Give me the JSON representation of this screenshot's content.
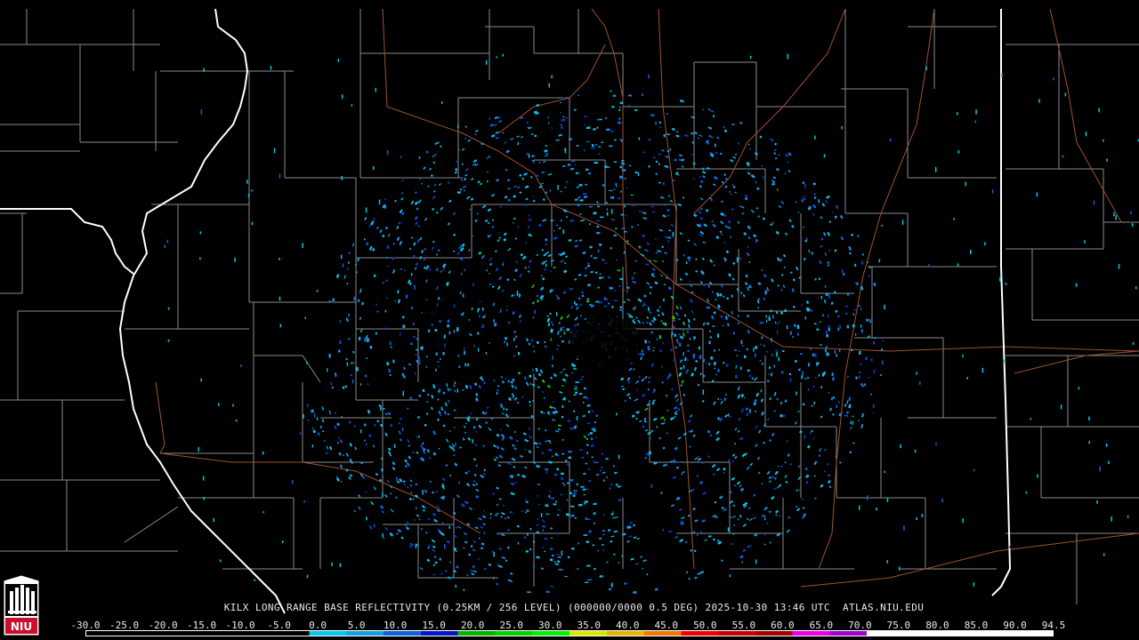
{
  "caption": "KILX LONG RANGE BASE REFLECTIVITY (0.25KM / 256 LEVEL) (000000/0000 0.5 DEG) 2025-10-30 13:46 UTC  ATLAS.NIU.EDU",
  "logo": {
    "text": "NIU",
    "background": "#c8102e"
  },
  "scale": {
    "labels": [
      "-30.0",
      "-25.0",
      "-20.0",
      "-15.0",
      "-10.0",
      "-5.0",
      "0.0",
      "5.0",
      "10.0",
      "15.0",
      "20.0",
      "25.0",
      "30.0",
      "35.0",
      "40.0",
      "45.0",
      "50.0",
      "55.0",
      "60.0",
      "65.0",
      "70.0",
      "75.0",
      "80.0",
      "85.0",
      "90.0",
      "94.5"
    ],
    "colors": [
      "#000000",
      "#000000",
      "#000000",
      "#000000",
      "#000000",
      "#000000",
      "#00c8e8",
      "#14a0e0",
      "#1060d8",
      "#0018c8",
      "#00b400",
      "#00d200",
      "#00f000",
      "#d8e800",
      "#e8b400",
      "#f07800",
      "#f00000",
      "#c80000",
      "#a00000",
      "#e800e8",
      "#a000c8",
      "#ffffff",
      "#ffffff",
      "#ffffff",
      "#ffffff",
      "#ffffff"
    ]
  },
  "map": {
    "radar_site": "KILX",
    "state_border_color": "#ffffff",
    "county_line_color": "#8c8c8c",
    "road_color": "#a0522d",
    "background": "#000000"
  }
}
